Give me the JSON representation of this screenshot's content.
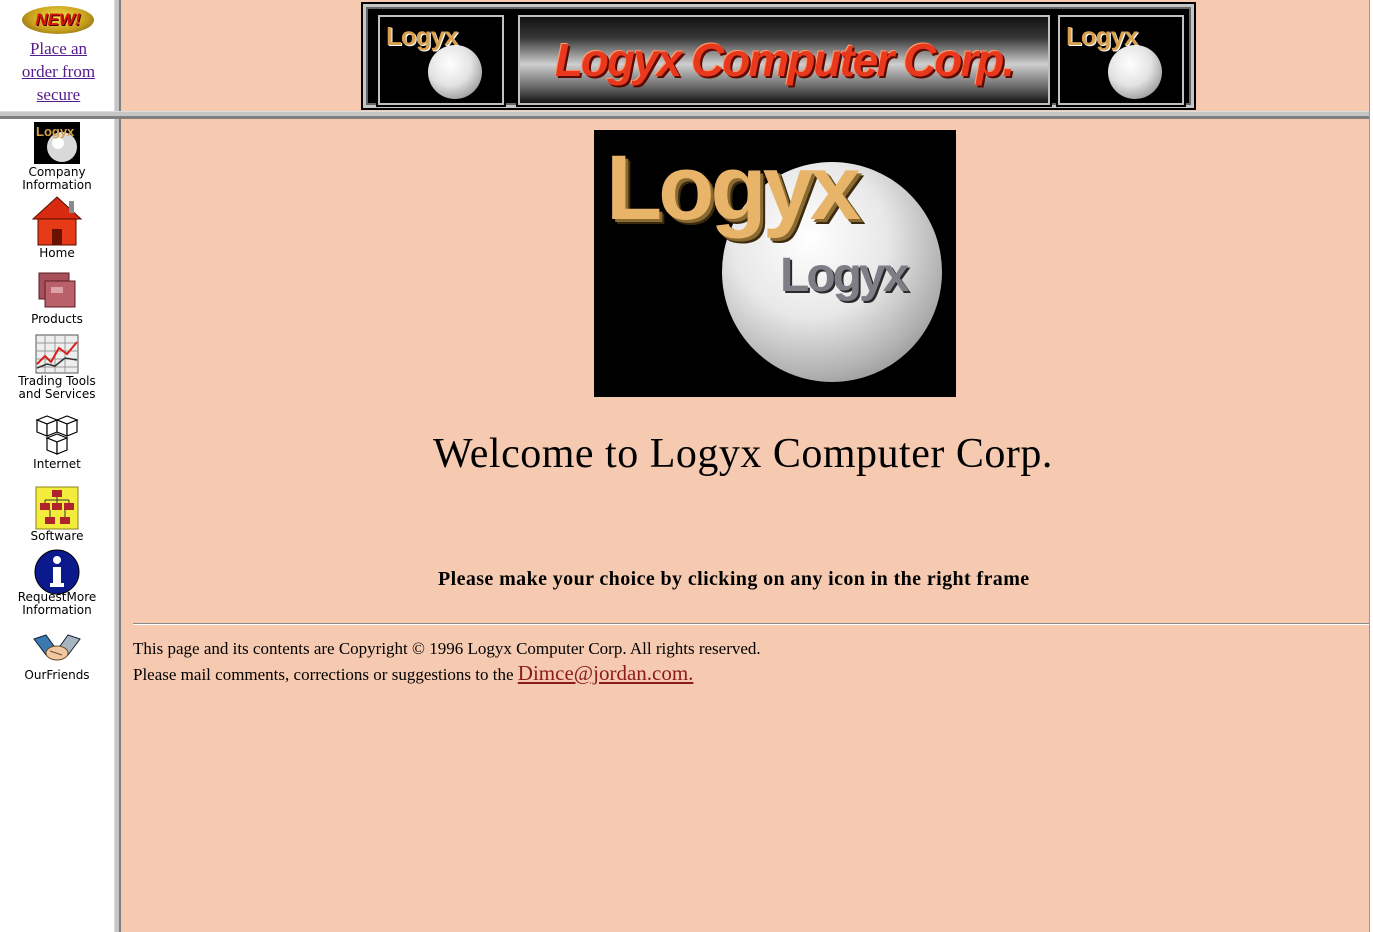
{
  "promo": {
    "badge": "NEW!",
    "link_lines": [
      "Place an",
      "order from",
      "secure"
    ]
  },
  "banner": {
    "title": "Logyx Computer Corp.",
    "logo_text": "Logyx"
  },
  "nav": {
    "items": [
      {
        "label": "Company Information",
        "icon": "company-logo-icon"
      },
      {
        "label": "Home",
        "icon": "house-icon"
      },
      {
        "label": "Products",
        "icon": "boxes-icon"
      },
      {
        "label": "Trading Tools and Services",
        "icon": "chart-icon"
      },
      {
        "label": "Internet",
        "icon": "network-cubes-icon"
      },
      {
        "label": "Software",
        "icon": "flowchart-icon"
      },
      {
        "label": "RequestMore Information",
        "icon": "info-icon"
      },
      {
        "label": "OurFriends",
        "icon": "handshake-icon"
      }
    ]
  },
  "main": {
    "hero_text": "Logyx",
    "hero_sub": "Logyx",
    "welcome": "Welcome to Logyx Computer Corp.",
    "instruction": "Please make your choice by clicking on any icon in the right frame",
    "copyright_line": "This page and its contents are Copyright © 1996 Logyx Computer Corp. All rights reserved.",
    "mail_prefix": "Please mail comments, corrections or suggestions to the ",
    "mail_link": "Dimce@jordan.com."
  },
  "colors": {
    "background": "#f5cab1",
    "link_visited": "#551a8b",
    "mail_link": "#8b1a1a",
    "banner_title": "#e8381d"
  }
}
